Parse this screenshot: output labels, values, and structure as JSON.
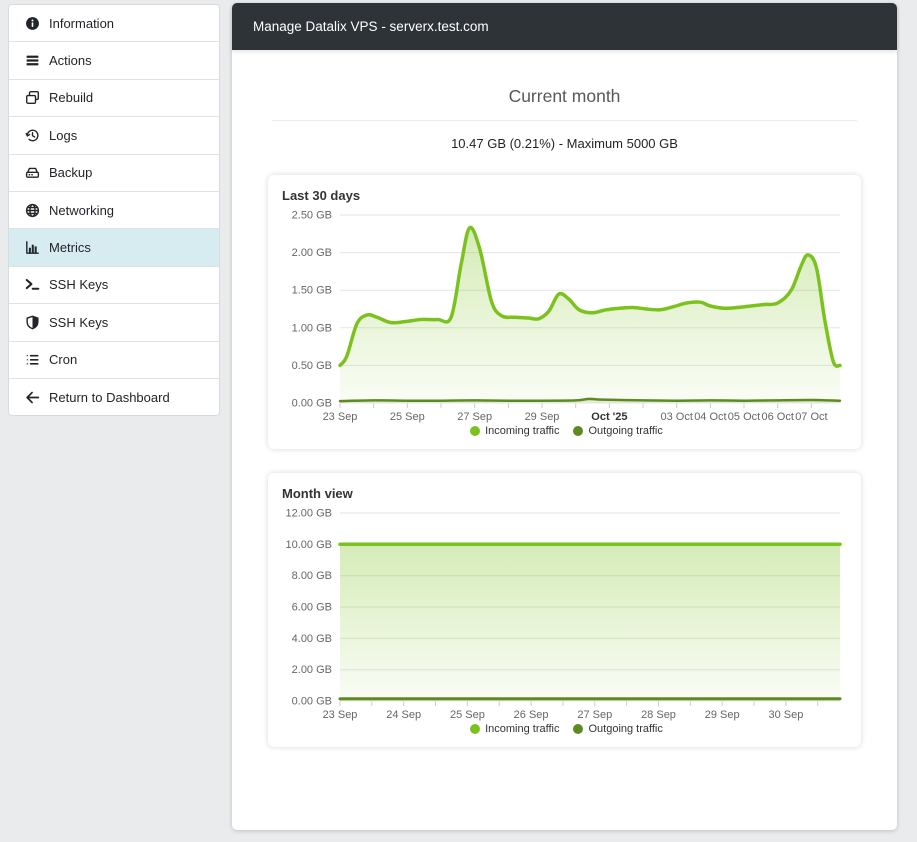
{
  "header": {
    "title": "Manage Datalix VPS - serverx.test.com"
  },
  "sidebar": {
    "items": [
      {
        "label": "Information",
        "icon": "info-circle-icon",
        "active": false
      },
      {
        "label": "Actions",
        "icon": "actions-list-icon",
        "active": false
      },
      {
        "label": "Rebuild",
        "icon": "rebuild-clone-icon",
        "active": false
      },
      {
        "label": "Logs",
        "icon": "logs-history-icon",
        "active": false
      },
      {
        "label": "Backup",
        "icon": "backup-drive-icon",
        "active": false
      },
      {
        "label": "Networking",
        "icon": "networking-globe-icon",
        "active": false
      },
      {
        "label": "Metrics",
        "icon": "metrics-chart-icon",
        "active": true
      },
      {
        "label": "SSH Keys",
        "icon": "terminal-icon",
        "active": false
      },
      {
        "label": "SSH Keys",
        "icon": "shield-icon",
        "active": false
      },
      {
        "label": "Cron",
        "icon": "cron-list-icon",
        "active": false
      },
      {
        "label": "Return to Dashboard",
        "icon": "arrow-left-icon",
        "active": false
      }
    ]
  },
  "main": {
    "section_title": "Current month",
    "usage_summary": "10.47 GB (0.21%) - Maximum 5000 GB"
  },
  "colors": {
    "incoming": "#7cc21e",
    "outgoing": "#5d8b20",
    "active_sidebar_bg": "#d6ecf1",
    "header_bg": "#2e3338",
    "grid": "#e5e5e5",
    "tick": "#cccccc",
    "axis_label": "#666666"
  },
  "chart_data": [
    {
      "type": "area",
      "title": "Last 30 days",
      "ylabel_unit": "GB",
      "ylim": [
        0,
        2.5
      ],
      "yticks": [
        {
          "v": 0.0,
          "label": "0.00 GB"
        },
        {
          "v": 0.5,
          "label": "0.50 GB"
        },
        {
          "v": 1.0,
          "label": "1.00 GB"
        },
        {
          "v": 1.5,
          "label": "1.50 GB"
        },
        {
          "v": 2.0,
          "label": "2.00 GB"
        },
        {
          "v": 2.5,
          "label": "2.50 GB"
        }
      ],
      "xlim": [
        0,
        14.85
      ],
      "xticks": [
        {
          "pos": 0,
          "label": "23 Sep",
          "bold": false
        },
        {
          "pos": 2,
          "label": "25 Sep",
          "bold": false
        },
        {
          "pos": 4,
          "label": "27 Sep",
          "bold": false
        },
        {
          "pos": 6,
          "label": "29 Sep",
          "bold": false
        },
        {
          "pos": 8,
          "label": "Oct '25",
          "bold": true
        },
        {
          "pos": 10,
          "label": "03 Oct",
          "bold": false
        },
        {
          "pos": 11,
          "label": "04 Oct",
          "bold": false
        },
        {
          "pos": 12,
          "label": "05 Oct",
          "bold": false
        },
        {
          "pos": 13,
          "label": "06 Oct",
          "bold": false
        },
        {
          "pos": 14,
          "label": "07 Oct",
          "bold": false
        }
      ],
      "tick_marks_every": 1,
      "series": [
        {
          "name": "Incoming traffic",
          "color": "#7cc21e",
          "line_width": 3.5,
          "points": [
            [
              0,
              0.5
            ],
            [
              0.2,
              0.62
            ],
            [
              0.5,
              1.05
            ],
            [
              0.8,
              1.17
            ],
            [
              1.1,
              1.14
            ],
            [
              1.5,
              1.07
            ],
            [
              1.9,
              1.08
            ],
            [
              2.4,
              1.11
            ],
            [
              2.9,
              1.11
            ],
            [
              3.3,
              1.14
            ],
            [
              3.6,
              1.85
            ],
            [
              3.85,
              2.33
            ],
            [
              4.15,
              2.05
            ],
            [
              4.5,
              1.35
            ],
            [
              4.8,
              1.16
            ],
            [
              5.2,
              1.14
            ],
            [
              5.6,
              1.13
            ],
            [
              5.9,
              1.12
            ],
            [
              6.2,
              1.22
            ],
            [
              6.5,
              1.45
            ],
            [
              6.8,
              1.38
            ],
            [
              7.1,
              1.24
            ],
            [
              7.5,
              1.2
            ],
            [
              7.9,
              1.24
            ],
            [
              8.3,
              1.26
            ],
            [
              8.7,
              1.27
            ],
            [
              9.1,
              1.25
            ],
            [
              9.5,
              1.24
            ],
            [
              9.9,
              1.28
            ],
            [
              10.3,
              1.33
            ],
            [
              10.7,
              1.34
            ],
            [
              11.0,
              1.29
            ],
            [
              11.4,
              1.26
            ],
            [
              11.8,
              1.27
            ],
            [
              12.2,
              1.29
            ],
            [
              12.6,
              1.31
            ],
            [
              13.0,
              1.33
            ],
            [
              13.4,
              1.5
            ],
            [
              13.7,
              1.83
            ],
            [
              13.9,
              1.97
            ],
            [
              14.15,
              1.8
            ],
            [
              14.4,
              1.1
            ],
            [
              14.65,
              0.55
            ],
            [
              14.85,
              0.5
            ]
          ]
        },
        {
          "name": "Outgoing traffic",
          "color": "#5d8b20",
          "line_width": 2.5,
          "points": [
            [
              0,
              0.025
            ],
            [
              1,
              0.035
            ],
            [
              2,
              0.03
            ],
            [
              3,
              0.03
            ],
            [
              4,
              0.035
            ],
            [
              5,
              0.03
            ],
            [
              6,
              0.03
            ],
            [
              7,
              0.035
            ],
            [
              7.4,
              0.055
            ],
            [
              7.8,
              0.045
            ],
            [
              9,
              0.035
            ],
            [
              10,
              0.03
            ],
            [
              11,
              0.035
            ],
            [
              12,
              0.03
            ],
            [
              13,
              0.035
            ],
            [
              14,
              0.04
            ],
            [
              14.85,
              0.03
            ]
          ]
        }
      ],
      "legend": [
        "Incoming traffic",
        "Outgoing traffic"
      ],
      "legend_position": "bottom-center",
      "grid": true
    },
    {
      "type": "area",
      "title": "Month view",
      "ylabel_unit": "GB",
      "ylim": [
        0,
        12
      ],
      "yticks": [
        {
          "v": 0,
          "label": "0.00 GB"
        },
        {
          "v": 2,
          "label": "2.00 GB"
        },
        {
          "v": 4,
          "label": "4.00 GB"
        },
        {
          "v": 6,
          "label": "6.00 GB"
        },
        {
          "v": 8,
          "label": "8.00 GB"
        },
        {
          "v": 10,
          "label": "10.00 GB"
        },
        {
          "v": 12,
          "label": "12.00 GB"
        }
      ],
      "xlim": [
        0,
        7.85
      ],
      "xticks": [
        {
          "pos": 0,
          "label": "23 Sep",
          "bold": false
        },
        {
          "pos": 1,
          "label": "24 Sep",
          "bold": false
        },
        {
          "pos": 2,
          "label": "25 Sep",
          "bold": false
        },
        {
          "pos": 3,
          "label": "26 Sep",
          "bold": false
        },
        {
          "pos": 4,
          "label": "27 Sep",
          "bold": false
        },
        {
          "pos": 5,
          "label": "28 Sep",
          "bold": false
        },
        {
          "pos": 6,
          "label": "29 Sep",
          "bold": false
        },
        {
          "pos": 7,
          "label": "30 Sep",
          "bold": false
        }
      ],
      "tick_marks_every": 0.5,
      "series": [
        {
          "name": "Incoming traffic",
          "color": "#7cc21e",
          "line_width": 3.5,
          "points": [
            [
              0,
              10.0
            ],
            [
              4,
              10.0
            ],
            [
              7.85,
              10.0
            ]
          ]
        },
        {
          "name": "Outgoing traffic",
          "color": "#5d8b20",
          "line_width": 3,
          "points": [
            [
              0,
              0.15
            ],
            [
              4,
              0.15
            ],
            [
              7.85,
              0.15
            ]
          ]
        }
      ],
      "legend": [
        "Incoming traffic",
        "Outgoing traffic"
      ],
      "legend_position": "bottom-center",
      "grid": true
    }
  ]
}
